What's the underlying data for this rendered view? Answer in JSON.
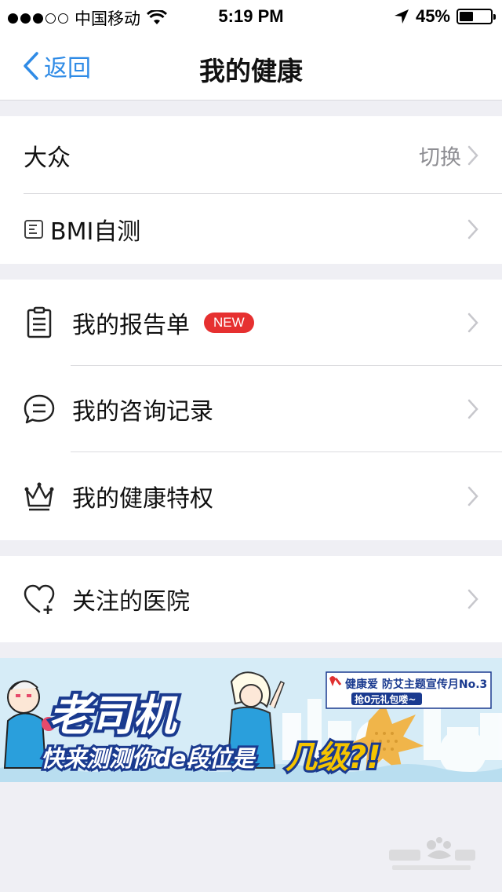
{
  "status_bar": {
    "carrier": "中国移动",
    "time": "5:19 PM",
    "battery": "45%",
    "battery_level": 0.45
  },
  "nav": {
    "back_label": "返回",
    "title": "我的健康"
  },
  "section1": {
    "profile_label": "大众",
    "switch_label": "切换",
    "bmi_label": "BMI自测"
  },
  "section2": {
    "items": [
      {
        "label": "我的报告单",
        "badge": "NEW",
        "icon": "report-icon"
      },
      {
        "label": "我的咨询记录",
        "icon": "chat-icon"
      },
      {
        "label": "我的健康特权",
        "icon": "crown-icon"
      }
    ]
  },
  "section3": {
    "items": [
      {
        "label": "关注的医院",
        "icon": "heart-plus-icon"
      }
    ]
  },
  "banner": {
    "headline": "老司机",
    "subline_1": "快来测测你de段位是",
    "subline_2": "几级?!",
    "tag_line": "健康爱 防艾主题宣传月No.3",
    "tag_sub": "抢0元礼包喽~"
  },
  "colors": {
    "accent": "#2f8be6",
    "badge": "#e63030",
    "background": "#efeff4"
  }
}
